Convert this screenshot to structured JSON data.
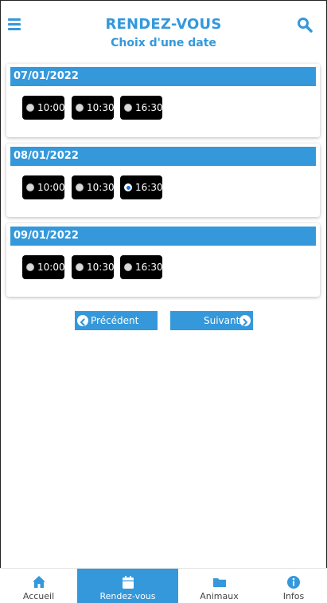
{
  "header": {
    "title": "RENDEZ-VOUS",
    "subtitle": "Choix d'une date",
    "menu_icon": "hamburger-icon",
    "search_icon": "search-icon"
  },
  "days": [
    {
      "date": "07/01/2022",
      "slots": [
        {
          "time": "10:00",
          "selected": false
        },
        {
          "time": "10:30",
          "selected": false
        },
        {
          "time": "16:30",
          "selected": false
        }
      ]
    },
    {
      "date": "08/01/2022",
      "slots": [
        {
          "time": "10:00",
          "selected": false
        },
        {
          "time": "10:30",
          "selected": false
        },
        {
          "time": "16:30",
          "selected": true
        }
      ]
    },
    {
      "date": "09/01/2022",
      "slots": [
        {
          "time": "10:00",
          "selected": false
        },
        {
          "time": "10:30",
          "selected": false
        },
        {
          "time": "16:30",
          "selected": false
        }
      ]
    }
  ],
  "pager": {
    "prev_label": "Précédent",
    "next_label": "Suivant",
    "prev_icon": "chevron-left-circle-icon",
    "next_icon": "chevron-right-circle-icon"
  },
  "nav": {
    "active": "rendez-vous",
    "items": [
      {
        "id": "accueil",
        "label": "Accueil",
        "icon": "home-icon"
      },
      {
        "id": "rendez-vous",
        "label": "Rendez-vous",
        "icon": "calendar-icon"
      },
      {
        "id": "animaux",
        "label": "Animaux",
        "icon": "folder-icon"
      },
      {
        "id": "infos",
        "label": "Infos",
        "icon": "info-icon"
      }
    ]
  },
  "colors": {
    "accent": "#3498db",
    "slot_bg": "#000000",
    "selected_radio": "#1a73e8"
  }
}
